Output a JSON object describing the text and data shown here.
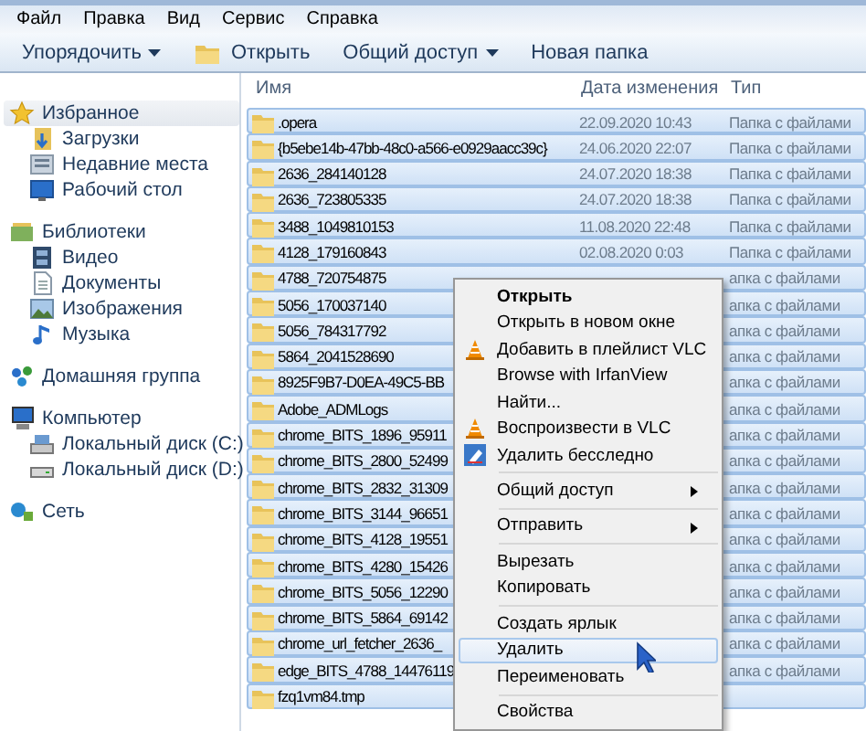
{
  "menu_bar": [
    "Файл",
    "Правка",
    "Вид",
    "Сервис",
    "Справка"
  ],
  "toolbar": [
    {
      "label": "Упорядочить",
      "kind": "dropdown"
    },
    {
      "label": "Открыть",
      "kind": "open"
    },
    {
      "label": "Общий доступ",
      "kind": "dropdown"
    },
    {
      "label": "Новая папка",
      "kind": "plain"
    }
  ],
  "sidebar": [
    {
      "label": "Избранное",
      "selected": true,
      "children": [
        {
          "label": "Загрузки"
        },
        {
          "label": "Недавние места"
        },
        {
          "label": "Рабочий стол"
        }
      ]
    },
    {
      "label": "Библиотеки",
      "selected": false,
      "children": [
        {
          "label": "Видео"
        },
        {
          "label": "Документы"
        },
        {
          "label": "Изображения"
        },
        {
          "label": "Музыка"
        }
      ]
    },
    {
      "label": "Домашняя группа",
      "selected": false
    },
    {
      "label": "Компьютер",
      "selected": false,
      "children": [
        {
          "label": "Локальный диск (C:)"
        },
        {
          "label": "Локальный диск (D:)"
        }
      ]
    },
    {
      "label": "Сеть",
      "selected": false
    }
  ],
  "file_list": {
    "columns": [
      "Имя",
      "Дата изменения",
      "Тип"
    ],
    "rows": [
      {
        "name": ".opera",
        "date": "22.09.2020 10:43",
        "type": "Папка с файлами",
        "selected": true
      },
      {
        "name": "{b5ebe14b-47bb-48c0-a566-e0929aacc39c}",
        "date": "24.06.2020 22:07",
        "type": "Папка с файлами",
        "selected": true
      },
      {
        "name": "2636_284140128",
        "date": "24.07.2020 18:38",
        "type": "Папка с файлами",
        "selected": true
      },
      {
        "name": "2636_723805335",
        "date": "24.07.2020 18:38",
        "type": "Папка с файлами",
        "selected": true
      },
      {
        "name": "3488_1049810153",
        "date": "11.08.2020 22:48",
        "type": "Папка с файлами",
        "selected": true
      },
      {
        "name": "4128_179160843",
        "date": "02.08.2020 0:03",
        "type": "Папка с файлами",
        "selected": true
      },
      {
        "name": "4788_720754875",
        "type": "апка с файлами",
        "selected": true
      },
      {
        "name": "5056_170037140",
        "type": "апка с файлами",
        "selected": true
      },
      {
        "name": "5056_784317792",
        "type": "апка с файлами",
        "selected": true
      },
      {
        "name": "5864_2041528690",
        "type": "апка с файлами",
        "selected": true
      },
      {
        "name": "8925F9B7-D0EA-49C5-BB",
        "type": "апка с файлами",
        "selected": true
      },
      {
        "name": "Adobe_ADMLogs",
        "type": "апка с файлами",
        "selected": true
      },
      {
        "name": "chrome_BITS_1896_95911",
        "type": "апка с файлами",
        "selected": true
      },
      {
        "name": "chrome_BITS_2800_52499",
        "type": "апка с файлами",
        "selected": true
      },
      {
        "name": "chrome_BITS_2832_31309",
        "type": "апка с файлами",
        "selected": true
      },
      {
        "name": "chrome_BITS_3144_96651",
        "type": "апка с файлами",
        "selected": true
      },
      {
        "name": "chrome_BITS_4128_19551",
        "type": "апка с файлами",
        "selected": true
      },
      {
        "name": "chrome_BITS_4280_15426",
        "type": "апка с файлами",
        "selected": true
      },
      {
        "name": "chrome_BITS_5056_12290",
        "type": "апка с файлами",
        "selected": true
      },
      {
        "name": "chrome_BITS_5864_69142",
        "type": "апка с файлами",
        "selected": true
      },
      {
        "name": "chrome_url_fetcher_2636_",
        "type": "апка с файлами",
        "selected": true
      },
      {
        "name": "edge_BITS_4788_14476119",
        "type": "апка с файлами",
        "selected": true
      },
      {
        "name": "fzq1vm84.tmp",
        "selected": true
      }
    ]
  },
  "context_menu": [
    {
      "kind": "item",
      "label": "Открыть",
      "default": true
    },
    {
      "kind": "item",
      "label": "Открыть в новом окне"
    },
    {
      "kind": "item",
      "label": "Добавить в плейлист VLC"
    },
    {
      "kind": "item",
      "label": "Browse with IrfanView"
    },
    {
      "kind": "item",
      "label": "Найти..."
    },
    {
      "kind": "item",
      "label": "Воспроизвести в VLC"
    },
    {
      "kind": "item",
      "label": "Удалить бесследно"
    },
    {
      "kind": "separator"
    },
    {
      "kind": "submenu",
      "label": "Общий доступ"
    },
    {
      "kind": "separator"
    },
    {
      "kind": "submenu",
      "label": "Отправить"
    },
    {
      "kind": "separator"
    },
    {
      "kind": "item",
      "label": "Вырезать"
    },
    {
      "kind": "item",
      "label": "Копировать"
    },
    {
      "kind": "separator"
    },
    {
      "kind": "item",
      "label": "Создать ярлык"
    },
    {
      "kind": "item",
      "label": "Удалить",
      "hovered": true
    },
    {
      "kind": "item",
      "label": "Переименовать"
    },
    {
      "kind": "separator"
    },
    {
      "kind": "item",
      "label": "Свойства"
    }
  ]
}
